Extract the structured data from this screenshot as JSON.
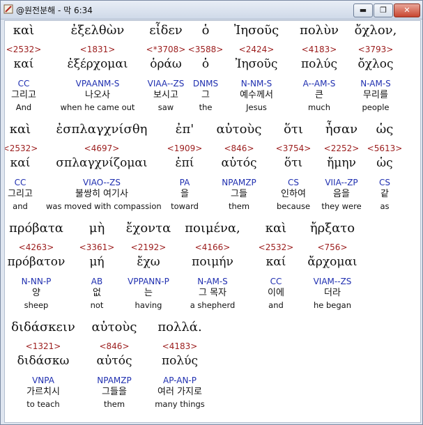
{
  "window": {
    "title": "@원전분해 - 막 6:34",
    "minimize": "▬",
    "maximize": "❐",
    "close": "✕",
    "app_icon": "scroll-icon"
  },
  "rows": [
    {
      "words": [
        {
          "greek": "καὶ",
          "strong": "<2532>",
          "lemma": "καί",
          "parse": "CC",
          "korean": "그리고",
          "english": "And"
        },
        {
          "greek": "ἐξελθὼν",
          "strong": "<1831>",
          "lemma": "ἐξέρχομαι",
          "parse": "VPAANM-S",
          "korean": "나오사",
          "english": "when he came out"
        },
        {
          "greek": "εἶδεν",
          "strong": "<*3708>",
          "lemma": "ὁράω",
          "parse": "VIAA--ZS",
          "korean": "보시고",
          "english": "saw"
        },
        {
          "greek": "ὁ",
          "strong": "<3588>",
          "lemma": "ὁ",
          "parse": "DNMS",
          "korean": "그",
          "english": "the"
        },
        {
          "greek": "Ἰησοῦς",
          "strong": "<2424>",
          "lemma": "Ἰησοῦς",
          "parse": "N-NM-S",
          "korean": "예수께서",
          "english": "Jesus"
        },
        {
          "greek": "πολὺν",
          "strong": "<4183>",
          "lemma": "πολύς",
          "parse": "A--AM-S",
          "korean": "큰",
          "english": "much"
        },
        {
          "greek": "ὄχλον,",
          "strong": "<3793>",
          "lemma": "ὄχλος",
          "parse": "N-AM-S",
          "korean": "무리를",
          "english": "people"
        }
      ]
    },
    {
      "words": [
        {
          "greek": "καὶ",
          "strong": "<2532>",
          "lemma": "καί",
          "parse": "CC",
          "korean": "그리고",
          "english": "and"
        },
        {
          "greek": "ἐσπλαγχνίσθη",
          "strong": "<4697>",
          "lemma": "σπλαγχνίζομαι",
          "parse": "VIAO--ZS",
          "korean": "불쌍히 여기사",
          "english": "was moved with compassion"
        },
        {
          "greek": "ἐπ'",
          "strong": "<1909>",
          "lemma": "ἐπί",
          "parse": "PA",
          "korean": "을",
          "english": "toward"
        },
        {
          "greek": "αὐτοὺς",
          "strong": "<846>",
          "lemma": "αὐτός",
          "parse": "NPAMZP",
          "korean": "그들",
          "english": "them"
        },
        {
          "greek": "ὅτι",
          "strong": "<3754>",
          "lemma": "ὅτι",
          "parse": "CS",
          "korean": "인하여",
          "english": "because"
        },
        {
          "greek": "ἦσαν",
          "strong": "<2252>",
          "lemma": "ἤμην",
          "parse": "VIIA--ZP",
          "korean": "음을",
          "english": "they were"
        },
        {
          "greek": "ὡς",
          "strong": "<5613>",
          "lemma": "ὡς",
          "parse": "CS",
          "korean": "같",
          "english": "as"
        }
      ]
    },
    {
      "words": [
        {
          "greek": "πρόβατα",
          "strong": "<4263>",
          "lemma": "πρόβατον",
          "parse": "N-NN-P",
          "korean": "양",
          "english": "sheep"
        },
        {
          "greek": "μὴ",
          "strong": "<3361>",
          "lemma": "μή",
          "parse": "AB",
          "korean": "없",
          "english": "not"
        },
        {
          "greek": "ἔχοντα",
          "strong": "<2192>",
          "lemma": "ἔχω",
          "parse": "VPPANN-P",
          "korean": "는",
          "english": "having"
        },
        {
          "greek": "ποιμένα,",
          "strong": "<4166>",
          "lemma": "ποιμήν",
          "parse": "N-AM-S",
          "korean": "그 목자",
          "english": "a shepherd"
        },
        {
          "greek": "καὶ",
          "strong": "<2532>",
          "lemma": "καί",
          "parse": "CC",
          "korean": "이에",
          "english": "and"
        },
        {
          "greek": "ἤρξατο",
          "strong": "<756>",
          "lemma": "ἄρχομαι",
          "parse": "VIAM--ZS",
          "korean": "더라",
          "english": "he began"
        }
      ]
    },
    {
      "words": [
        {
          "greek": "διδάσκειν",
          "strong": "<1321>",
          "lemma": "διδάσκω",
          "parse": "VNPA",
          "korean": "가르치시",
          "english": "to teach"
        },
        {
          "greek": "αὐτοὺς",
          "strong": "<846>",
          "lemma": "αὐτός",
          "parse": "NPAMZP",
          "korean": "그들을",
          "english": "them"
        },
        {
          "greek": "πολλά.",
          "strong": "<4183>",
          "lemma": "πολύς",
          "parse": "AP-AN-P",
          "korean": "여러 가지로",
          "english": "many things"
        }
      ]
    }
  ]
}
